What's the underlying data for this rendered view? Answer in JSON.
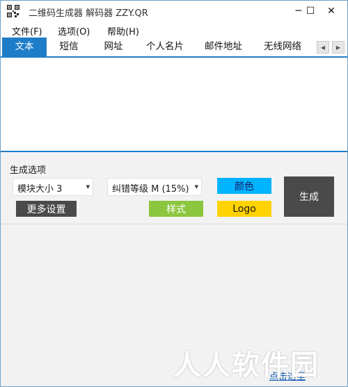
{
  "window": {
    "title": "二维码生成器 解码器 ZZY.QR",
    "controls": {
      "minimize": "─",
      "maximize": "☐",
      "close": "✕"
    }
  },
  "menu": [
    "文件(F)",
    "选项(O)",
    "帮助(H)"
  ],
  "tabs": [
    "文本",
    "短信",
    "网址",
    "个人名片",
    "邮件地址",
    "无线网络"
  ],
  "active_tab": "文本",
  "tab_scroll": {
    "left": "◀",
    "right": "▶"
  },
  "content": {
    "text": ""
  },
  "options": {
    "label": "生成选项",
    "module_size": {
      "value": "模块大小 3",
      "arrow": "▼"
    },
    "ec_level": {
      "value": "纠错等级 M (15%)",
      "arrow": "▼"
    }
  },
  "buttons": {
    "more_settings": "更多设置",
    "style": "样式",
    "color": "颜色",
    "logo": "Logo",
    "generate": "生成"
  },
  "colors": {
    "accent": "#1e7dc8",
    "color_btn": "#00b4ff",
    "style_btn": "#8cc63f",
    "logo_btn": "#ffd200",
    "generate_btn": "#4a4a4a",
    "more_btn": "#4a4a4a"
  },
  "footer": {
    "link": "点击这里",
    "watermark": "人人软件园"
  }
}
